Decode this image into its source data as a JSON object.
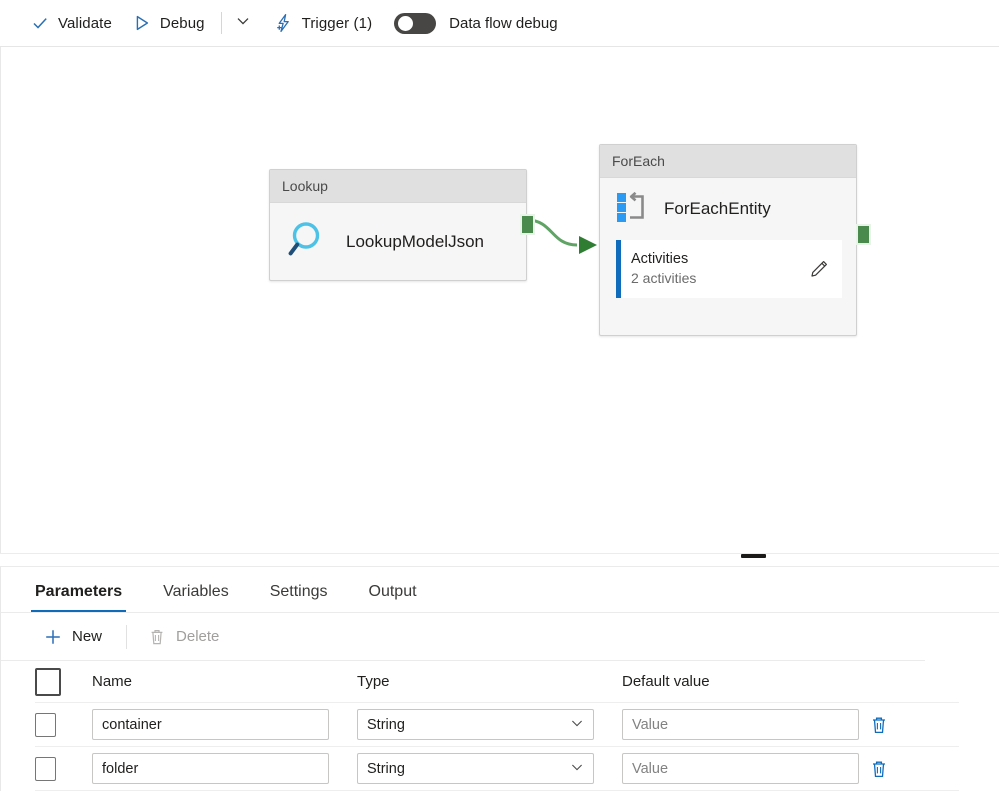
{
  "toolbar": {
    "validate": {
      "label": "Validate",
      "icon": "checkmark-icon"
    },
    "debug": {
      "label": "Debug",
      "icon": "play-triangle-icon"
    },
    "caret": {
      "icon": "chevron-down-icon"
    },
    "trigger": {
      "label": "Trigger (1)",
      "icon": "lightning-add-icon"
    },
    "dataflow": {
      "label": "Data flow debug",
      "state": "off",
      "icon": "toggle-off-icon"
    }
  },
  "canvas": {
    "nodes": [
      {
        "type_label": "Lookup",
        "name": "LookupModelJson",
        "icon": "magnifier-icon"
      },
      {
        "type_label": "ForEach",
        "name": "ForEachEntity",
        "icon": "foreach-loop-icon",
        "sub": {
          "title": "Activities",
          "count_label": "2 activities",
          "edit_icon": "pencil-icon"
        }
      }
    ],
    "handles": {
      "lookup_output": "output-handle",
      "foreach_output": "output-handle"
    },
    "connector_color": "#5fa365"
  },
  "splitter": {
    "grip": "resize-grip"
  },
  "panel": {
    "tabs": [
      {
        "label": "Parameters",
        "active": true
      },
      {
        "label": "Variables",
        "active": false
      },
      {
        "label": "Settings",
        "active": false
      },
      {
        "label": "Output",
        "active": false
      }
    ],
    "commands": {
      "new": {
        "label": "New",
        "icon": "plus-icon",
        "disabled": false
      },
      "delete": {
        "label": "Delete",
        "icon": "trash-icon",
        "disabled": true
      }
    },
    "table": {
      "headers": {
        "name": "Name",
        "type": "Type",
        "value": "Default value"
      },
      "rows": [
        {
          "name": "container",
          "type": "String",
          "value_placeholder": "Value",
          "selected": false
        },
        {
          "name": "folder",
          "type": "String",
          "value_placeholder": "Value",
          "selected": false
        }
      ]
    }
  },
  "colors": {
    "accent": "#0f6cbd",
    "green": "#4a8b4d",
    "green_line": "#5fa365",
    "lookup_cyan": "#4cc2e6",
    "node_header": "#e0e0e0"
  }
}
